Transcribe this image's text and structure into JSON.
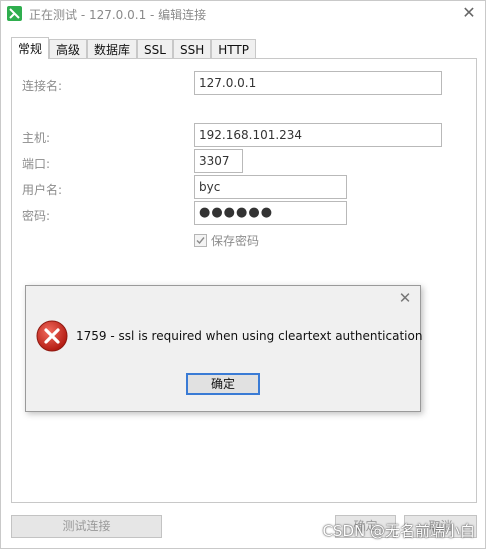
{
  "window": {
    "title": "正在测试 - 127.0.0.1 - 编辑连接",
    "close_glyph": "✕"
  },
  "tabs": [
    {
      "label": "常规"
    },
    {
      "label": "高级"
    },
    {
      "label": "数据库"
    },
    {
      "label": "SSL"
    },
    {
      "label": "SSH"
    },
    {
      "label": "HTTP"
    }
  ],
  "form": {
    "connection_name_label": "连接名:",
    "connection_name_value": "127.0.0.1",
    "host_label": "主机:",
    "host_value": "192.168.101.234",
    "port_label": "端口:",
    "port_value": "3307",
    "user_label": "用户名:",
    "user_value": "byc",
    "password_label": "密码:",
    "password_value": "●●●●●●",
    "save_password_label": "保存密码",
    "save_password_checked": true
  },
  "dialog": {
    "close_glyph": "✕",
    "message": "1759 - ssl is required when using cleartext authentication",
    "ok_label": "确定",
    "icon": "error-icon"
  },
  "bottom": {
    "test_button_label": "测试连接",
    "ok_label": "确定",
    "cancel_label": "取消"
  },
  "watermark": "CSDN @无名前端小白",
  "colors": {
    "accent": "#3a7bd5",
    "error_red": "#d52b1e",
    "app_icon_green": "#2fae4e"
  }
}
